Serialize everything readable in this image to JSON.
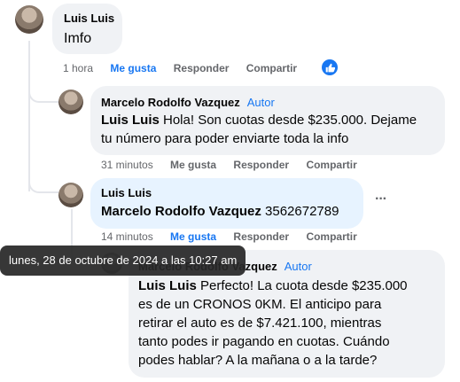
{
  "comments": [
    {
      "author": "Luis Luis",
      "text": "Imfo",
      "time": "1 hora",
      "like": "Me gusta",
      "reply": "Responder",
      "share": "Compartir"
    },
    {
      "author": "Marcelo Rodolfo Vazquez",
      "badge": "Autor",
      "mention": "Luis Luis",
      "text_line1": " Hola! Son cuotas desde $235.000. Dejame",
      "text_line2": "tu número para poder enviarte toda la info",
      "time": "31 minutos",
      "like": "Me gusta",
      "reply": "Responder",
      "share": "Compartir"
    },
    {
      "author": "Luis Luis",
      "mention": "Marcelo Rodolfo Vazquez",
      "text": " 3562672789",
      "more": "···",
      "time": "14 minutos",
      "like": "Me gusta",
      "reply": "Responder",
      "share": "Compartir"
    },
    {
      "author": "Marcelo Rodolfo Vazquez",
      "badge": "Autor",
      "mention": "Luis Luis",
      "text_line1": " Perfecto! La cuota desde $235.000",
      "text_line2": "es de un CRONOS 0KM. El anticipo para",
      "text_line3": "retirar el auto es de $7.421.100, mientras",
      "text_line4": "tanto podes ir pagando en cuotas. Cuándo",
      "text_line5": "podes hablar? A la mañana o a la tarde?"
    }
  ],
  "tooltip": "lunes, 28 de octubre de 2024 a las 10:27 am",
  "colors": {
    "link": "#1877f2",
    "bubble": "#f0f2f5",
    "bubble_active": "#e7f3ff",
    "meta": "#65676b"
  }
}
